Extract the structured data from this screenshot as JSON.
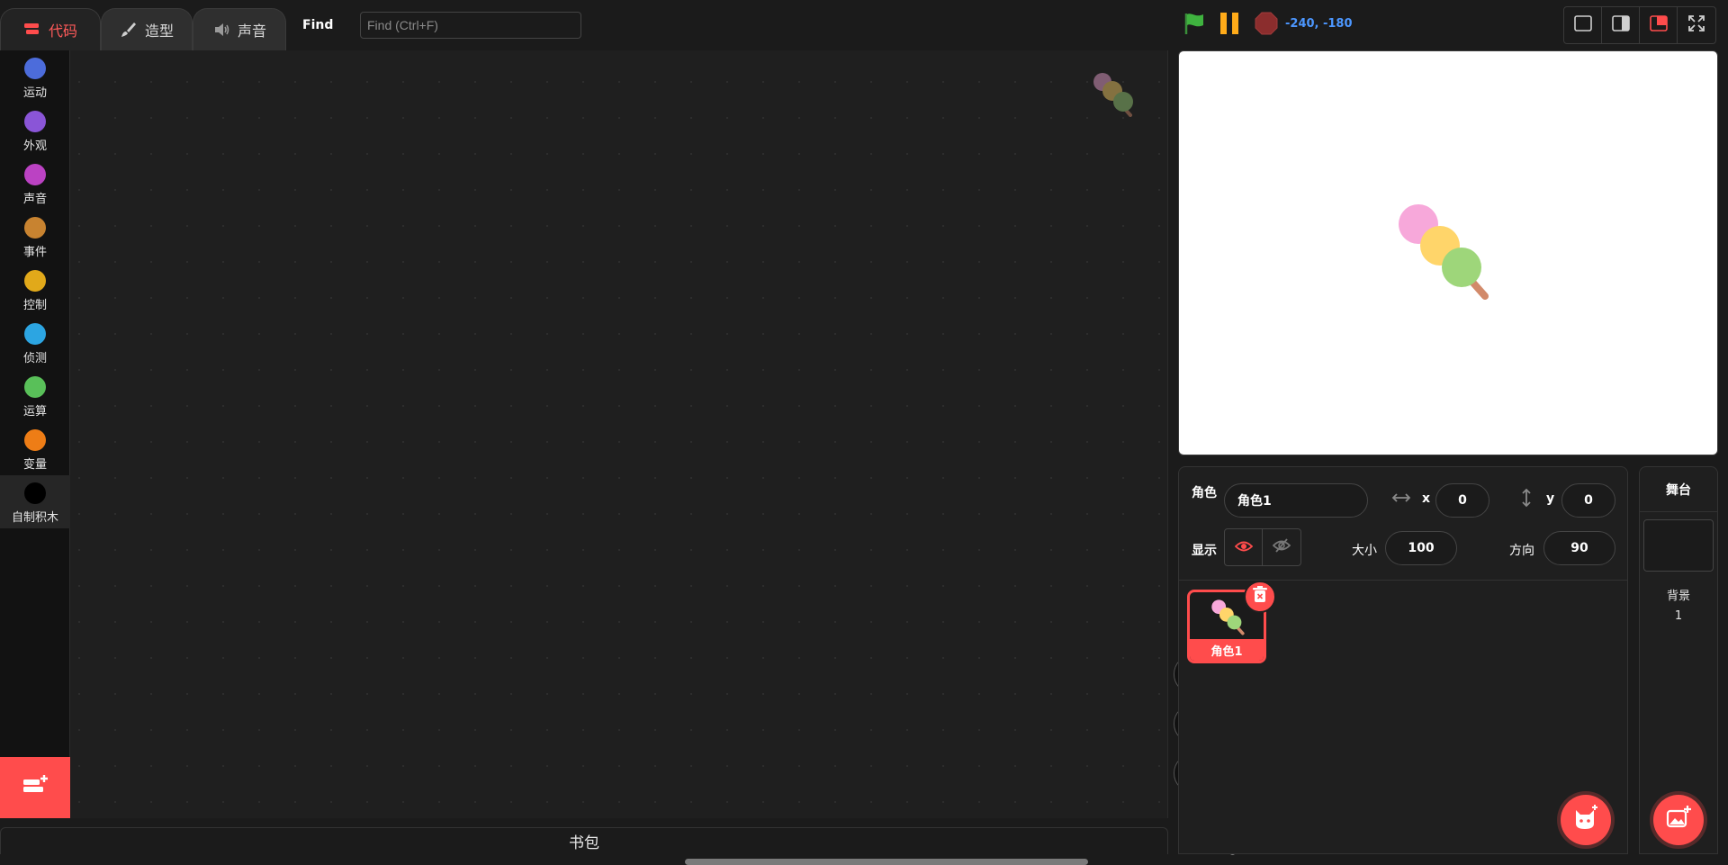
{
  "tabs": [
    {
      "label": "代码",
      "icon": "code-blocks-icon",
      "active": true
    },
    {
      "label": "造型",
      "icon": "brush-icon",
      "active": false
    },
    {
      "label": "声音",
      "icon": "speaker-icon",
      "active": false
    }
  ],
  "find": {
    "label": "Find",
    "placeholder": "Find (Ctrl+F)",
    "value": ""
  },
  "controls": {
    "green_flag": "green-flag-icon",
    "pause": "pause-icon",
    "stop": "stop-icon",
    "coordinates": "-240, -180"
  },
  "layout_buttons": [
    "small-stage-icon",
    "normal-stage-icon",
    "large-stage-icon",
    "fullscreen-icon"
  ],
  "categories": [
    {
      "label": "运动",
      "color": "#4c6cdb"
    },
    {
      "label": "外观",
      "color": "#8a55d7"
    },
    {
      "label": "声音",
      "color": "#bb42c3"
    },
    {
      "label": "事件",
      "color": "#c88330"
    },
    {
      "label": "控制",
      "color": "#e1a91a"
    },
    {
      "label": "侦测",
      "color": "#2ca5e2"
    },
    {
      "label": "运算",
      "color": "#59c059"
    },
    {
      "label": "变量",
      "color": "#ee7d16"
    },
    {
      "label": "自制积木",
      "color": "#000000"
    }
  ],
  "backpack": {
    "label": "书包"
  },
  "sprite_info": {
    "sprite_label": "角色",
    "sprite_name": "角色1",
    "x_label": "x",
    "x_value": "0",
    "y_label": "y",
    "y_value": "0",
    "show_label": "显示",
    "size_label": "大小",
    "size_value": "100",
    "direction_label": "方向",
    "direction_value": "90"
  },
  "sprites": [
    {
      "name": "角色1",
      "selected": true
    }
  ],
  "stage_pane": {
    "header": "舞台",
    "backdrop_label": "背景",
    "backdrop_count": "1"
  },
  "colors": {
    "accent": "#ff4c4c",
    "coords": "#4c97ff",
    "flag": "#3fb33f",
    "pause": "#ffab19",
    "stop": "#8b2d2d"
  }
}
